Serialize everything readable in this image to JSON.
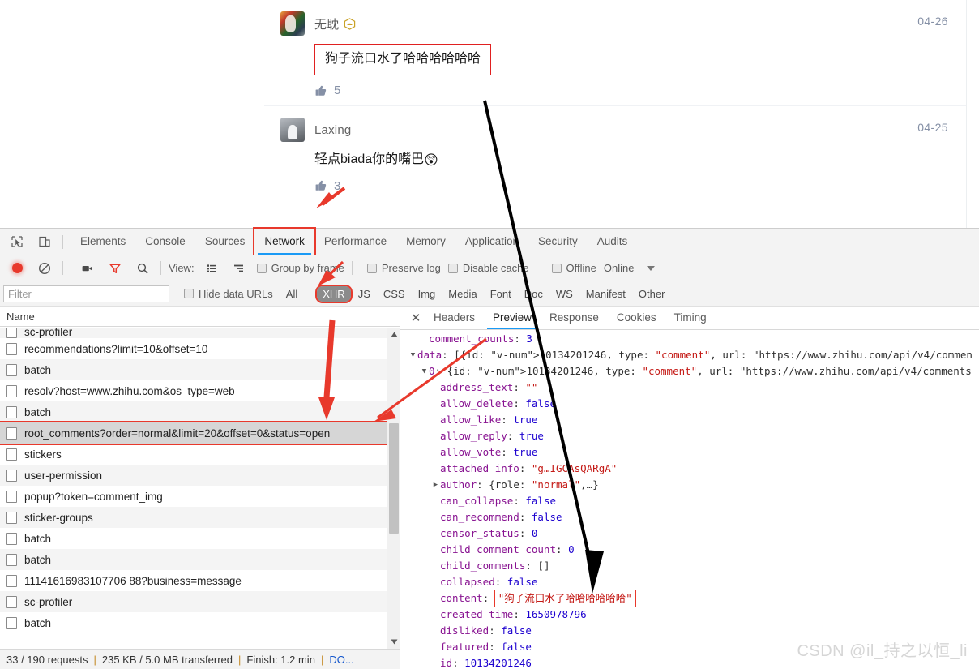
{
  "page": {
    "comments": [
      {
        "author": "无耽",
        "badge": "hexagon-badge-icon",
        "date": "04-26",
        "text": "狗子流口水了哈哈哈哈哈哈",
        "likes": "5",
        "highlighted": true
      },
      {
        "author": "Laxing",
        "date": "04-25",
        "text": "轻点biada你的嘴巴",
        "emoji": "😲",
        "likes": "3",
        "highlighted": false
      }
    ]
  },
  "devtools": {
    "tabs": [
      {
        "label": "Elements",
        "active": false
      },
      {
        "label": "Console",
        "active": false
      },
      {
        "label": "Sources",
        "active": false
      },
      {
        "label": "Network",
        "active": true
      },
      {
        "label": "Performance",
        "active": false
      },
      {
        "label": "Memory",
        "active": false
      },
      {
        "label": "Application",
        "active": false
      },
      {
        "label": "Security",
        "active": false
      },
      {
        "label": "Audits",
        "active": false
      }
    ],
    "toolbar": {
      "record_icon": "record-dot-icon",
      "clear_icon": "clear-no-entry-icon",
      "capture_screenshots_icon": "camera-icon",
      "filter_icon": "funnel-icon",
      "search_icon": "magnifier-icon",
      "view_label": "View:",
      "view_list_icon": "list-view-icon",
      "view_waterfall_icon": "waterfall-view-icon",
      "group_by_frame": "Group by frame",
      "preserve_log": "Preserve log",
      "disable_cache": "Disable cache",
      "offline": "Offline",
      "throttle_value": "Online"
    },
    "filterbar": {
      "filter_placeholder": "Filter",
      "hide_data_urls": "Hide data URLs",
      "types": [
        {
          "label": "All",
          "selected": false
        },
        {
          "label": "XHR",
          "selected": true
        },
        {
          "label": "JS",
          "selected": false
        },
        {
          "label": "CSS",
          "selected": false
        },
        {
          "label": "Img",
          "selected": false
        },
        {
          "label": "Media",
          "selected": false
        },
        {
          "label": "Font",
          "selected": false
        },
        {
          "label": "Doc",
          "selected": false
        },
        {
          "label": "WS",
          "selected": false
        },
        {
          "label": "Manifest",
          "selected": false
        },
        {
          "label": "Other",
          "selected": false
        }
      ]
    },
    "network_list": {
      "column_header": "Name",
      "rows": [
        {
          "name": "sc-profiler",
          "partial": true,
          "selected": false
        },
        {
          "name": "recommendations?limit=10&offset=10",
          "selected": false
        },
        {
          "name": "batch",
          "selected": false
        },
        {
          "name": "resolv?host=www.zhihu.com&os_type=web",
          "selected": false
        },
        {
          "name": "batch",
          "selected": false
        },
        {
          "name": "root_comments?order=normal&limit=20&offset=0&status=open",
          "selected": true
        },
        {
          "name": "stickers",
          "selected": false
        },
        {
          "name": "user-permission",
          "selected": false
        },
        {
          "name": "popup?token=comment_img",
          "selected": false
        },
        {
          "name": "sticker-groups",
          "selected": false
        },
        {
          "name": "batch",
          "selected": false
        },
        {
          "name": "batch",
          "selected": false
        },
        {
          "name": "11141616983107706 88?business=message",
          "selected": false
        },
        {
          "name": "sc-profiler",
          "selected": false
        },
        {
          "name": "batch",
          "selected": false
        }
      ],
      "row_names": [
        "sc-profiler",
        "recommendations?limit=10&offset=10",
        "batch",
        "resolv?host=www.zhihu.com&os_type=web",
        "batch",
        "root_comments?order=normal&limit=20&offset=0&status=open",
        "stickers",
        "user-permission",
        "popup?token=comment_img",
        "sticker-groups",
        "batch",
        "batch",
        "11141616983107706 88?business=message",
        "sc-profiler",
        "batch"
      ],
      "status": {
        "requests": "33 / 190 requests",
        "transferred": "235 KB / 5.0 MB transferred",
        "finish": "Finish: 1.2 min",
        "dom": "DO..."
      }
    },
    "detail": {
      "close_icon": "close-x-icon",
      "tabs": [
        {
          "label": "Headers",
          "active": false
        },
        {
          "label": "Preview",
          "active": true
        },
        {
          "label": "Response",
          "active": false
        },
        {
          "label": "Cookies",
          "active": false
        },
        {
          "label": "Timing",
          "active": false
        }
      ],
      "json_lines": [
        {
          "indent": 1,
          "tri": "",
          "key": "comment_counts",
          "sep": ": ",
          "value": "3",
          "vtype": "num"
        },
        {
          "indent": 0,
          "tri": "▼",
          "key": "data",
          "sep": ": ",
          "value": "[{id: 10134201246, type: \"comment\", url: \"https://www.zhihu.com/api/v4/commen",
          "vtype": "mixed"
        },
        {
          "indent": 1,
          "tri": "▼",
          "key": "0",
          "sep": ": ",
          "value": "{id: 10134201246, type: \"comment\", url: \"https://www.zhihu.com/api/v4/comments",
          "vtype": "mixed"
        },
        {
          "indent": 2,
          "tri": "",
          "key": "address_text",
          "sep": ": ",
          "value": "\"\"",
          "vtype": "str"
        },
        {
          "indent": 2,
          "tri": "",
          "key": "allow_delete",
          "sep": ": ",
          "value": "false",
          "vtype": "bool"
        },
        {
          "indent": 2,
          "tri": "",
          "key": "allow_like",
          "sep": ": ",
          "value": "true",
          "vtype": "bool"
        },
        {
          "indent": 2,
          "tri": "",
          "key": "allow_reply",
          "sep": ": ",
          "value": "true",
          "vtype": "bool"
        },
        {
          "indent": 2,
          "tri": "",
          "key": "allow_vote",
          "sep": ": ",
          "value": "true",
          "vtype": "bool"
        },
        {
          "indent": 2,
          "tri": "",
          "key": "attached_info",
          "sep": ": ",
          "value": "\"g…IGCAsQARgA\"",
          "vtype": "str"
        },
        {
          "indent": 2,
          "tri": "▶",
          "key": "author",
          "sep": ": ",
          "value": "{role: \"normal\",…}",
          "vtype": "mixed"
        },
        {
          "indent": 2,
          "tri": "",
          "key": "can_collapse",
          "sep": ": ",
          "value": "false",
          "vtype": "bool"
        },
        {
          "indent": 2,
          "tri": "",
          "key": "can_recommend",
          "sep": ": ",
          "value": "false",
          "vtype": "bool"
        },
        {
          "indent": 2,
          "tri": "",
          "key": "censor_status",
          "sep": ": ",
          "value": "0",
          "vtype": "num"
        },
        {
          "indent": 2,
          "tri": "",
          "key": "child_comment_count",
          "sep": ": ",
          "value": "0",
          "vtype": "num"
        },
        {
          "indent": 2,
          "tri": "",
          "key": "child_comments",
          "sep": ": ",
          "value": "[]",
          "vtype": "plain"
        },
        {
          "indent": 2,
          "tri": "",
          "key": "collapsed",
          "sep": ": ",
          "value": "false",
          "vtype": "bool"
        },
        {
          "indent": 2,
          "tri": "",
          "key": "content",
          "sep": ": ",
          "value": "\"狗子流口水了哈哈哈哈哈哈\"",
          "vtype": "str",
          "highlight": true
        },
        {
          "indent": 2,
          "tri": "",
          "key": "created_time",
          "sep": ": ",
          "value": "1650978796",
          "vtype": "num"
        },
        {
          "indent": 2,
          "tri": "",
          "key": "disliked",
          "sep": ": ",
          "value": "false",
          "vtype": "bool"
        },
        {
          "indent": 2,
          "tri": "",
          "key": "featured",
          "sep": ": ",
          "value": "false",
          "vtype": "bool"
        },
        {
          "indent": 2,
          "tri": "",
          "key": "id",
          "sep": ": ",
          "value": "10134201246",
          "vtype": "num"
        }
      ]
    }
  },
  "watermark": "CSDN @il_持之以恒_li",
  "colors": {
    "accent_blue": "#1a9af5",
    "annotation_red": "#e8392c",
    "selected_filter_bg": "#8b8b8b",
    "link_blue": "#1155cc"
  }
}
